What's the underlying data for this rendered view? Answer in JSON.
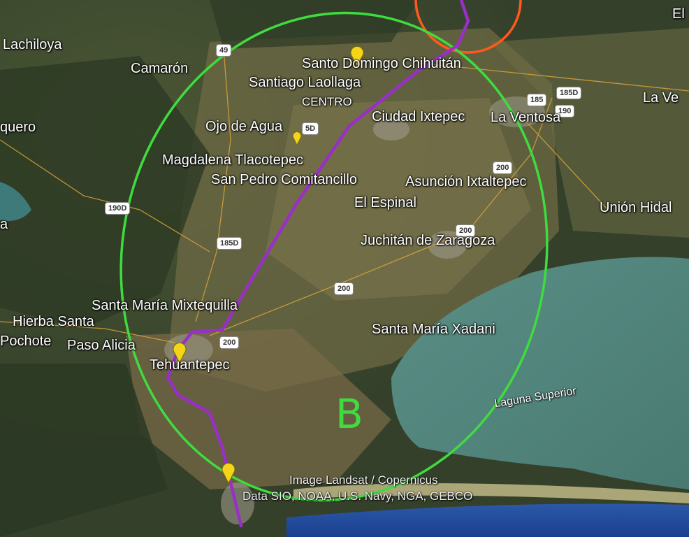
{
  "places": [
    {
      "id": "lachiloya",
      "label": "Lachiloya"
    },
    {
      "id": "camaron",
      "label": "Camarón"
    },
    {
      "id": "quero",
      "label": "quero"
    },
    {
      "id": "santo-domingo-chihuitan",
      "label": "Santo Domingo Chihuitán"
    },
    {
      "id": "santiago-laollaga",
      "label": "Santiago Laollaga"
    },
    {
      "id": "centro",
      "label": "CENTRO"
    },
    {
      "id": "ojo-de-agua",
      "label": "Ojo de Agua"
    },
    {
      "id": "ciudad-ixtepec",
      "label": "Ciudad Ixtepec"
    },
    {
      "id": "la-ventosa",
      "label": "La Ventosa"
    },
    {
      "id": "la-ve",
      "label": "La Ve"
    },
    {
      "id": "el",
      "label": "El"
    },
    {
      "id": "magdalena-tlacotepec",
      "label": "Magdalena Tlacotepec"
    },
    {
      "id": "san-pedro-comitancillo",
      "label": "San Pedro Comitancillo"
    },
    {
      "id": "asuncion-ixtaltepec",
      "label": "Asunción Ixtaltepec"
    },
    {
      "id": "el-espinal",
      "label": "El Espinal"
    },
    {
      "id": "union-hidal",
      "label": "Unión Hidal"
    },
    {
      "id": "juchitan",
      "label": "Juchitán de Zaragoza"
    },
    {
      "id": "santa-maria-mixtequilla",
      "label": "Santa María Mixtequilla"
    },
    {
      "id": "hierba-santa",
      "label": "Hierba Santa"
    },
    {
      "id": "pochote",
      "label": "Pochote"
    },
    {
      "id": "paso-alicia",
      "label": "Paso Alicia"
    },
    {
      "id": "tehuantepec",
      "label": "Tehuantepec"
    },
    {
      "id": "santa-maria-xadani",
      "label": "Santa María Xadani"
    },
    {
      "id": "a-left",
      "label": "a"
    }
  ],
  "highways": [
    "49",
    "185",
    "185D",
    "190",
    "190D",
    "185D",
    "200",
    "200",
    "200",
    "200",
    "5D"
  ],
  "water": {
    "laguna_superior": "Laguna Superior"
  },
  "zone": {
    "letter": "B",
    "color": "#3fdc3f"
  },
  "route_color": "#9a2fc8",
  "orange_zone_color": "#ff5a1a",
  "attribution": {
    "line1": "Image Landsat / Copernicus",
    "line2": "Data SIO, NOAA, U.S. Navy, NGA, GEBCO"
  }
}
